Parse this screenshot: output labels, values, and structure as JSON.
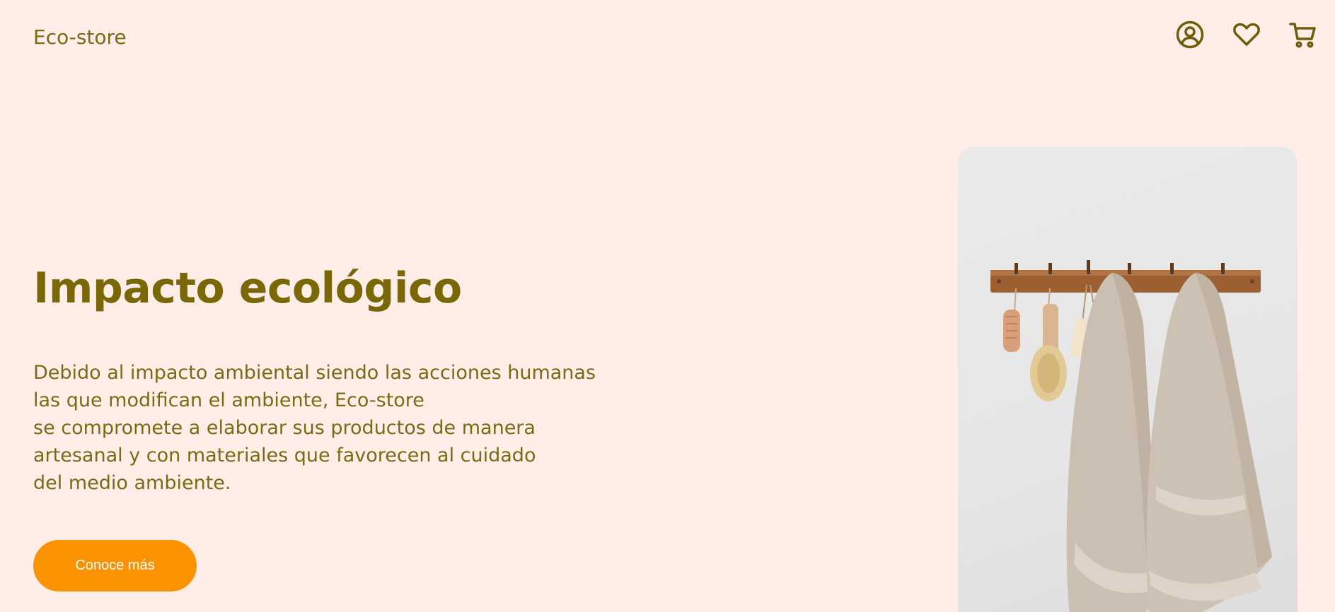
{
  "header": {
    "logo": "Eco-store",
    "icons": [
      "user-circle-icon",
      "heart-icon",
      "cart-icon"
    ]
  },
  "hero": {
    "title": "Impacto ecológico",
    "paragraph_lines": [
      "Debido al impacto ambiental siendo las acciones humanas",
      "las que modifican el ambiente, Eco-store",
      "se compromete a elaborar sus productos de manera",
      "artesanal y con materiales que favorecen al cuidado",
      "del medio ambiente."
    ],
    "button_label": "Conoce más"
  },
  "colors": {
    "background": "#ffeee7",
    "text": "#7a6a14",
    "accent": "#fb9300",
    "button_text": "#ffffff"
  }
}
